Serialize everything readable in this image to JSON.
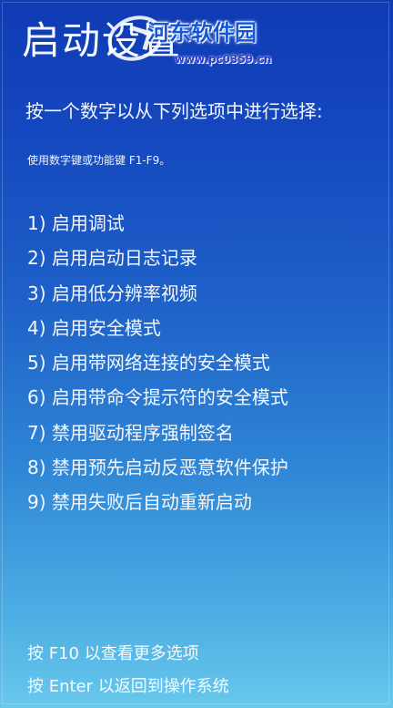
{
  "screen": {
    "title": "启动设置",
    "prompt": "按一个数字以从下列选项中进行选择:",
    "hint": "使用数字键或功能键 F1-F9。",
    "options": [
      {
        "label": "1) 启用调试"
      },
      {
        "label": "2) 启用启动日志记录"
      },
      {
        "label": "3) 启用低分辨率视频"
      },
      {
        "label": "4) 启用安全模式"
      },
      {
        "label": "5) 启用带网络连接的安全模式"
      },
      {
        "label": "6) 启用带命令提示符的安全模式"
      },
      {
        "label": "7) 禁用驱动程序强制签名"
      },
      {
        "label": "8) 禁用预先启动反恶意软件保护"
      },
      {
        "label": "9) 禁用失败后自动重新启动"
      }
    ],
    "footer": {
      "more_options": "按 F10 以查看更多选项",
      "return": "按 Enter 以返回到操作系统"
    }
  },
  "watermark": {
    "name": "河东软件园",
    "url": "www.pc0359.cn"
  },
  "colors": {
    "background_top": "#0f3bb5",
    "background_bottom": "#68c8ec",
    "text": "#f4f7ff",
    "watermark_text": "#1456d8"
  }
}
